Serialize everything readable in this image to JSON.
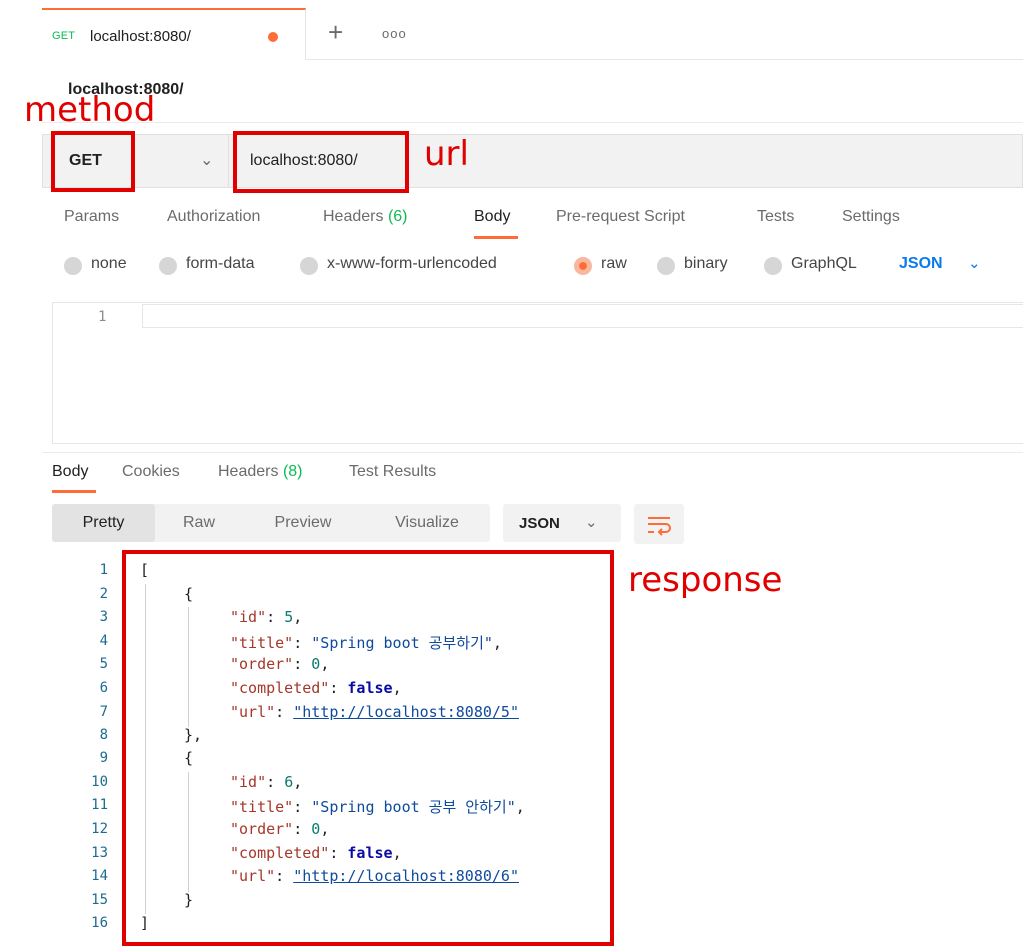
{
  "tab": {
    "method": "GET",
    "title": "localhost:8080/",
    "more": "ooo",
    "plus": "+"
  },
  "request": {
    "name": "localhost:8080/",
    "method": "GET",
    "url": "localhost:8080/"
  },
  "request_tabs": [
    {
      "label": "Params"
    },
    {
      "label": "Authorization"
    },
    {
      "label": "Headers",
      "count": "(6)"
    },
    {
      "label": "Body"
    },
    {
      "label": "Pre-request Script"
    },
    {
      "label": "Tests"
    },
    {
      "label": "Settings"
    }
  ],
  "active_request_tab": "Body",
  "body_types": [
    {
      "label": "none"
    },
    {
      "label": "form-data"
    },
    {
      "label": "x-www-form-urlencoded"
    },
    {
      "label": "raw"
    },
    {
      "label": "binary"
    },
    {
      "label": "GraphQL"
    }
  ],
  "selected_body_type": "raw",
  "body_format": "JSON",
  "editor": {
    "line_number": "1"
  },
  "response_tabs": [
    {
      "label": "Body"
    },
    {
      "label": "Cookies"
    },
    {
      "label": "Headers",
      "count": "(8)"
    },
    {
      "label": "Test Results"
    }
  ],
  "active_response_tab": "Body",
  "view_modes": [
    "Pretty",
    "Raw",
    "Preview",
    "Visualize"
  ],
  "active_view_mode": "Pretty",
  "response_format": "JSON",
  "response": {
    "line_numbers": [
      "1",
      "2",
      "3",
      "4",
      "5",
      "6",
      "7",
      "8",
      "9",
      "10",
      "11",
      "12",
      "13",
      "14",
      "15",
      "16"
    ],
    "items": [
      {
        "id": "5",
        "title": "\"Spring boot 공부하기\"",
        "order": "0",
        "completed": "false",
        "url": "\"http://localhost:8080/5\""
      },
      {
        "id": "6",
        "title": "\"Spring boot 공부 안하기\"",
        "order": "0",
        "completed": "false",
        "url": "\"http://localhost:8080/6\""
      }
    ]
  },
  "annotations": {
    "method": "method",
    "url": "url",
    "response": "response"
  },
  "colors": {
    "accent": "#ff6c37",
    "method_get": "#0cbb52",
    "link": "#097bed",
    "annotation": "#e00000"
  }
}
